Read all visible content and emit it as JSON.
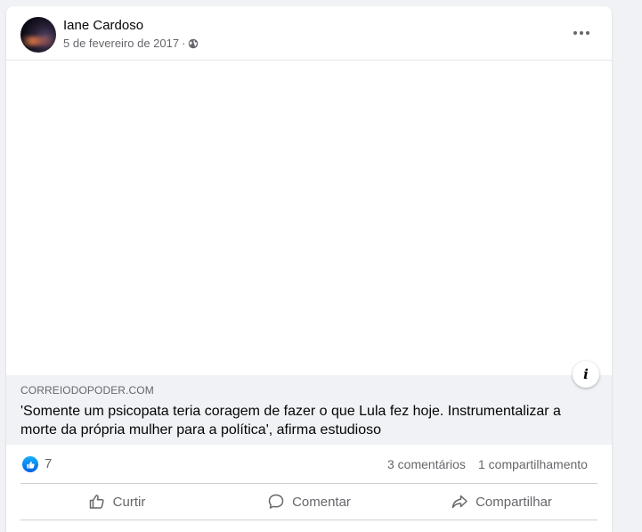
{
  "post": {
    "author": "Iane Cardoso",
    "date": "5 de fevereiro de 2017",
    "separator": "·",
    "privacy_icon": "globe-icon",
    "menu_icon": "more-icon"
  },
  "link_preview": {
    "domain": "CORREIODOPODER.COM",
    "headline": "'Somente um psicopata teria coragem de fazer o que Lula fez hoje. Instrumentalizar a morte da própria mulher para a política', afirma estudioso",
    "info_icon": "i"
  },
  "stats": {
    "reaction_icon": "like-icon",
    "reactions": "7",
    "comments": "3 comentários",
    "shares": "1 compartilhamento"
  },
  "actions": {
    "like": "Curtir",
    "comment": "Comentar",
    "share": "Compartilhar"
  },
  "colors": {
    "background": "#f0f2f5",
    "card": "#ffffff",
    "secondary_text": "#65676b",
    "like_blue": "#0866ff"
  }
}
